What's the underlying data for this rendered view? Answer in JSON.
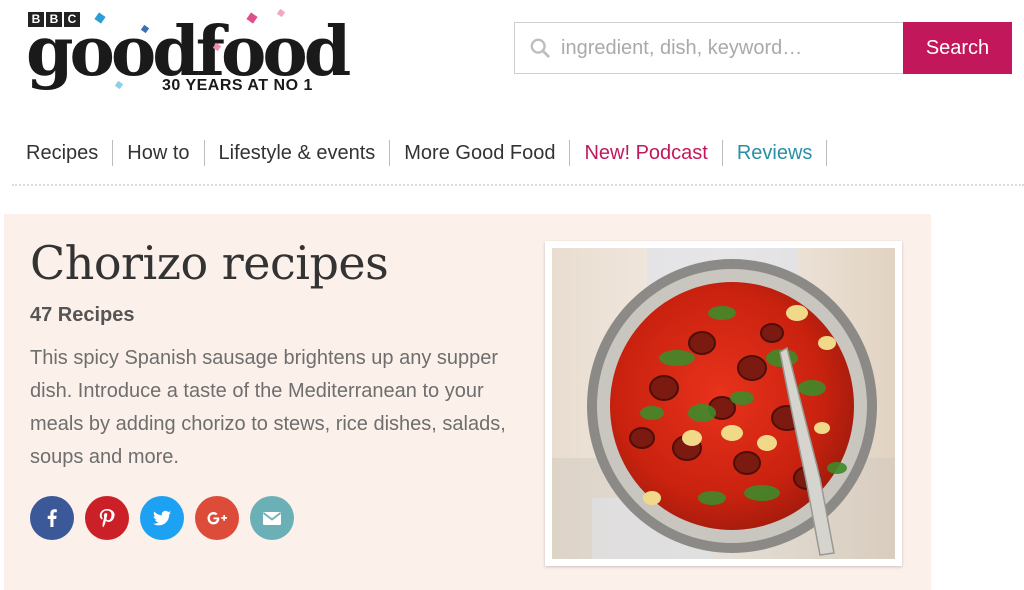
{
  "logo": {
    "bbc_letters": [
      "B",
      "B",
      "C"
    ],
    "wordmark": "goodfood",
    "tagline": "30 YEARS AT NO 1"
  },
  "search": {
    "placeholder": "ingredient, dish, keyword…",
    "button_label": "Search"
  },
  "nav": {
    "items": [
      {
        "label": "Recipes"
      },
      {
        "label": "How to"
      },
      {
        "label": "Lifestyle & events"
      },
      {
        "label": "More Good Food"
      },
      {
        "label": "New! Podcast"
      },
      {
        "label": "Reviews"
      }
    ]
  },
  "hero": {
    "title": "Chorizo recipes",
    "count": "47 Recipes",
    "description": "This spicy Spanish sausage brightens up any supper dish. Introduce a taste of the Mediterranean to your meals by adding chorizo to stews, rice dishes, salads, soups and more.",
    "social": [
      {
        "name": "facebook-icon",
        "color": "#3b5998"
      },
      {
        "name": "pinterest-icon",
        "color": "#cb2027"
      },
      {
        "name": "twitter-icon",
        "color": "#1da1f2"
      },
      {
        "name": "google-plus-icon",
        "color": "#dd4b39"
      },
      {
        "name": "email-icon",
        "color": "#6bb0b6"
      }
    ]
  },
  "colors": {
    "brand_pink": "#c2185b",
    "reviews_teal": "#2a8fa6",
    "hero_bg": "#fbf0ea"
  }
}
